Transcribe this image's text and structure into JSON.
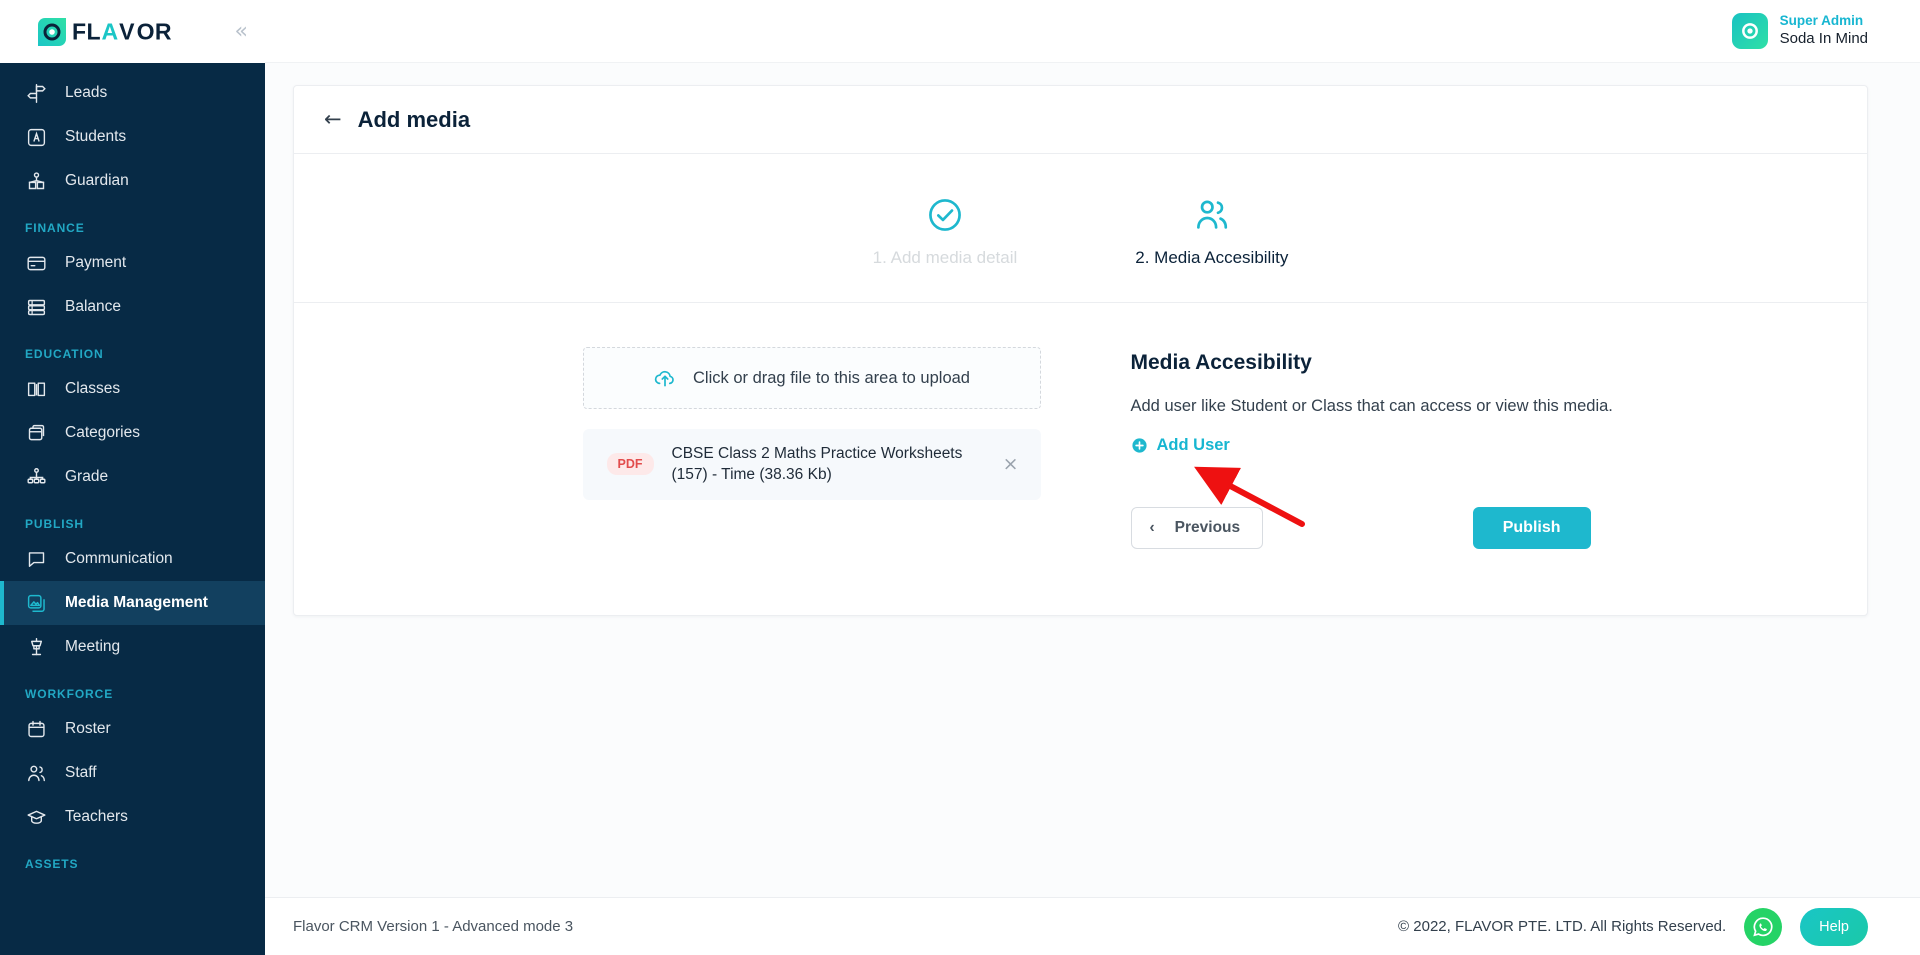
{
  "brand": {
    "logo_text": "FLAVOR",
    "accent": "#1EB8CE",
    "sidebar_bg": "#072A45",
    "sidebar_active_bg": "#12405F",
    "section_label_color": "#22a8c4"
  },
  "sidebar": {
    "collapse_glyph": "«",
    "groups": [
      {
        "label": "",
        "items": [
          {
            "label": "Leads",
            "icon": "signpost-icon",
            "active": false
          },
          {
            "label": "Students",
            "icon": "student-badge-icon",
            "active": false
          },
          {
            "label": "Guardian",
            "icon": "guardian-icon",
            "active": false
          }
        ]
      },
      {
        "label": "FINANCE",
        "items": [
          {
            "label": "Payment",
            "icon": "credit-card-icon",
            "active": false
          },
          {
            "label": "Balance",
            "icon": "stacked-database-icon",
            "active": false
          }
        ]
      },
      {
        "label": "EDUCATION",
        "items": [
          {
            "label": "Classes",
            "icon": "open-book-icon",
            "active": false
          },
          {
            "label": "Categories",
            "icon": "folder-stack-icon",
            "active": false
          },
          {
            "label": "Grade",
            "icon": "hierarchy-icon",
            "active": false
          }
        ]
      },
      {
        "label": "PUBLISH",
        "items": [
          {
            "label": "Communication",
            "icon": "chat-bubble-icon",
            "active": false
          },
          {
            "label": "Media Management",
            "icon": "image-stack-icon",
            "active": true
          },
          {
            "label": "Meeting",
            "icon": "podium-icon",
            "active": false
          }
        ]
      },
      {
        "label": "WORKFORCE",
        "items": [
          {
            "label": "Roster",
            "icon": "calendar-icon",
            "active": false
          },
          {
            "label": "Staff",
            "icon": "people-icon",
            "active": false
          },
          {
            "label": "Teachers",
            "icon": "graduation-cap-icon",
            "active": false
          }
        ]
      },
      {
        "label": "ASSETS",
        "items": []
      }
    ]
  },
  "topbar": {
    "account": {
      "role": "Super Admin",
      "name": "Soda In Mind"
    }
  },
  "page": {
    "back_glyph": "←",
    "title": "Add media",
    "steps": [
      {
        "label": "1. Add media detail",
        "state": "done",
        "icon": "check-circle-icon"
      },
      {
        "label": "2. Media Accesibility",
        "state": "current",
        "icon": "people-icon"
      }
    ]
  },
  "upload": {
    "dropzone_text": "Click or drag file to this area to upload",
    "dropzone_icon": "cloud-upload-icon",
    "files": [
      {
        "badge": "PDF",
        "name": "CBSE Class 2 Maths Practice Worksheets (157) - Time (38.36 Kb)",
        "remove_glyph": "×"
      }
    ]
  },
  "accessibility": {
    "title": "Media Accesibility",
    "description": "Add user like Student or Class that can access or view this media.",
    "add_user_label": "Add User",
    "add_user_icon": "plus-circle-icon"
  },
  "actions": {
    "previous_label": "Previous",
    "previous_glyph": "‹",
    "publish_label": "Publish"
  },
  "footer": {
    "version": "Flavor CRM Version 1 - Advanced mode 3",
    "copyright": "© 2022, FLAVOR PTE. LTD. All Rights Reserved.",
    "whatsapp_icon": "whatsapp-icon",
    "help_label": "Help"
  }
}
